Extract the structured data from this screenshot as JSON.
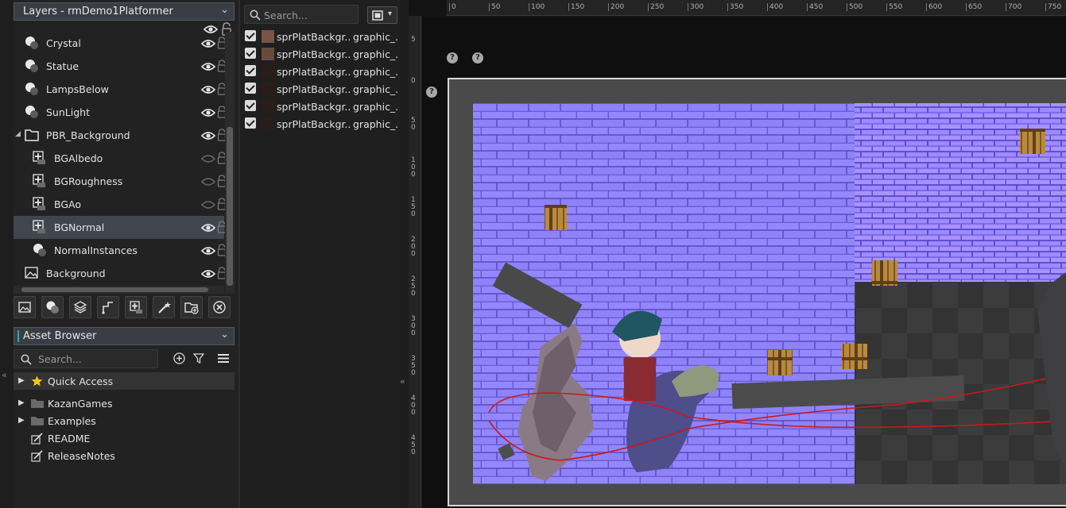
{
  "layers_panel": {
    "dropdown_label": "Layers - rmDemo1Platformer",
    "items": [
      {
        "label": "Crystal",
        "kind": "light",
        "visible": true,
        "indent": 1
      },
      {
        "label": "Statue",
        "kind": "light",
        "visible": true,
        "indent": 1
      },
      {
        "label": "LampsBelow",
        "kind": "light",
        "visible": true,
        "indent": 1
      },
      {
        "label": "SunLight",
        "kind": "light",
        "visible": true,
        "indent": 1
      },
      {
        "label": "PBR_Background",
        "kind": "folder",
        "visible": true,
        "indent": 0
      },
      {
        "label": "BGAlbedo",
        "kind": "asset",
        "visible": false,
        "indent": 2
      },
      {
        "label": "BGRoughness",
        "kind": "asset",
        "visible": false,
        "indent": 2
      },
      {
        "label": "BGAo",
        "kind": "asset",
        "visible": false,
        "indent": 2
      },
      {
        "label": "BGNormal",
        "kind": "asset",
        "visible": true,
        "indent": 2,
        "selected": true
      },
      {
        "label": "NormalInstances",
        "kind": "light",
        "visible": true,
        "indent": 2
      },
      {
        "label": "Background",
        "kind": "background",
        "visible": true,
        "indent": 1
      }
    ],
    "tool_icons": [
      "add-background-layer-icon",
      "add-instance-layer-icon",
      "add-tile-layer-icon",
      "add-path-layer-icon",
      "add-asset-layer-icon",
      "add-effect-layer-icon",
      "add-folder-icon",
      "delete-layer-icon"
    ]
  },
  "asset_browser": {
    "dropdown_label": "Asset Browser",
    "search_placeholder": "Search...",
    "tree": [
      {
        "label": "Quick Access",
        "icon": "star-icon",
        "expandable": true
      },
      {
        "label": "KazanGames",
        "icon": "folder-icon",
        "expandable": true
      },
      {
        "label": "Examples",
        "icon": "folder-icon",
        "expandable": true
      },
      {
        "label": "README",
        "icon": "note-icon",
        "expandable": false
      },
      {
        "label": "ReleaseNotes",
        "icon": "note-icon",
        "expandable": false
      }
    ]
  },
  "asset_layer_panel": {
    "search_placeholder": "Search...",
    "rows": [
      {
        "name": "sprPlatBackgr...",
        "group": "graphic_...",
        "checked": true,
        "swatch": "#7a5448"
      },
      {
        "name": "sprPlatBackgr...",
        "group": "graphic_...",
        "checked": true,
        "swatch": "#6b4a3e"
      },
      {
        "name": "sprPlatBackgr...",
        "group": "graphic_...",
        "checked": true,
        "swatch": "#2a1d18"
      },
      {
        "name": "sprPlatBackgr...",
        "group": "graphic_...",
        "checked": true,
        "swatch": "#2a1d18"
      },
      {
        "name": "sprPlatBackgr...",
        "group": "graphic_...",
        "checked": true,
        "swatch": "#2a1d18"
      },
      {
        "name": "sprPlatBackgr...",
        "group": "graphic_...",
        "checked": true,
        "swatch": "#2a1d18"
      }
    ]
  },
  "room_editor": {
    "ruler_top": [
      "0",
      "50",
      "100",
      "150",
      "200",
      "250",
      "300",
      "350",
      "400",
      "450",
      "500",
      "550",
      "600",
      "650",
      "700",
      "750"
    ],
    "ruler_left": [
      "5",
      "0",
      "5\n0",
      "1\n0\n0",
      "1\n5\n0",
      "2\n0\n0",
      "2\n5\n0",
      "3\n0\n0",
      "3\n5\n0",
      "4\n0\n0",
      "4\n5\n0"
    ],
    "help_badge": "?",
    "colors": {
      "brick": "#8a7ef0",
      "room_border": "#d8d8d8",
      "checker_a": "#3a3a3a",
      "checker_b": "#4a4a4a",
      "path": "#d21c1c"
    }
  }
}
